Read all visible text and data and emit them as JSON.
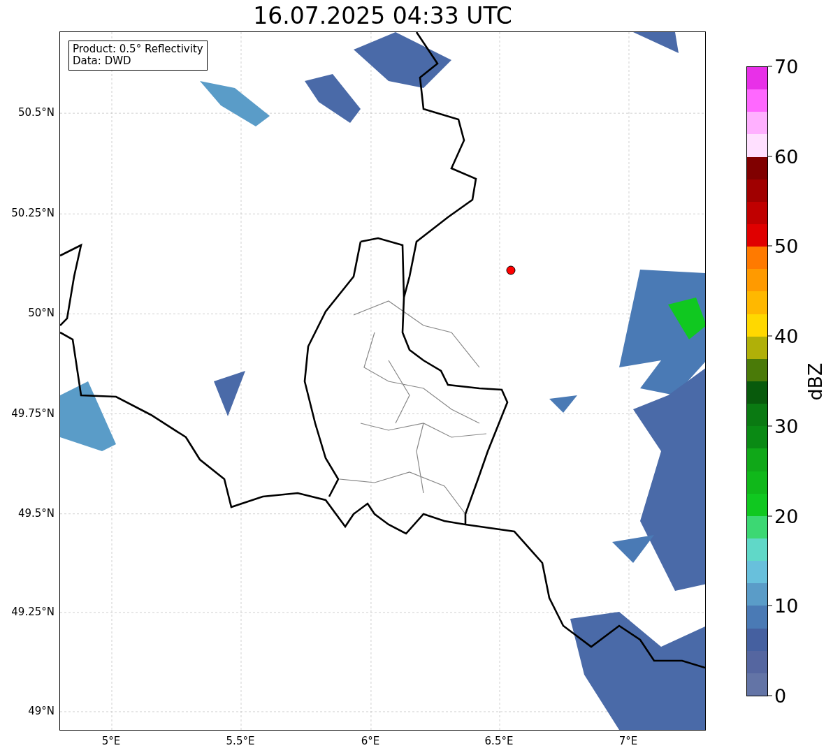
{
  "title": "16.07.2025 04:33 UTC",
  "info_box": {
    "lines": [
      "Product: 0.5° Reflectivity",
      "Data: DWD"
    ]
  },
  "y_ticks": [
    "50.5°N",
    "50.25°N",
    "50°N",
    "49.75°N",
    "49.5°N",
    "49.25°N",
    "49°N"
  ],
  "x_ticks": [
    "5°E",
    "5.5°E",
    "6°E",
    "6.5°E",
    "7°E"
  ],
  "colorbar": {
    "label": "dBZ",
    "ticks": [
      "70",
      "60",
      "50",
      "40",
      "30",
      "20",
      "10",
      "0"
    ],
    "segments": [
      {
        "color": "#e830e8"
      },
      {
        "color": "#ff68ff"
      },
      {
        "color": "#ffb0ff"
      },
      {
        "color": "#ffe0ff"
      },
      {
        "color": "#800000"
      },
      {
        "color": "#a00000"
      },
      {
        "color": "#c00000"
      },
      {
        "color": "#e00000"
      },
      {
        "color": "#ff7a00"
      },
      {
        "color": "#ff9a00"
      },
      {
        "color": "#ffb800"
      },
      {
        "color": "#ffd800"
      },
      {
        "color": "#b0b008"
      },
      {
        "color": "#4a7a08"
      },
      {
        "color": "#085a0c"
      },
      {
        "color": "#0a7a12"
      },
      {
        "color": "#0a8a14"
      },
      {
        "color": "#10a818"
      },
      {
        "color": "#10b81a"
      },
      {
        "color": "#10c820"
      },
      {
        "color": "#3cd873"
      },
      {
        "color": "#60d8c8"
      },
      {
        "color": "#68c0dc"
      },
      {
        "color": "#5a9cc8"
      },
      {
        "color": "#4a7ab5"
      },
      {
        "color": "#4560a0"
      },
      {
        "color": "#5566a0"
      },
      {
        "color": "#6374a6"
      }
    ]
  }
}
